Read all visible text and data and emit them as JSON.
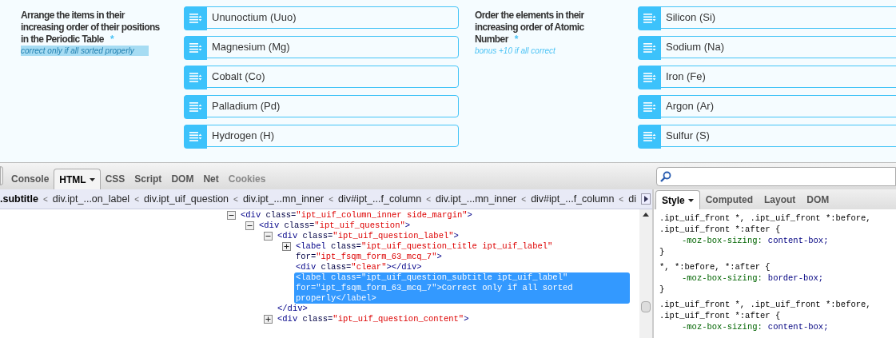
{
  "questions": [
    {
      "title": "Arrange the items in their increasing order of their positions in the Periodic Table",
      "required": "*",
      "subtitle": "correct only if all sorted properly",
      "highlighted": true,
      "items": [
        "Ununoctium (Uuo)",
        "Magnesium (Mg)",
        "Cobalt (Co)",
        "Palladium (Pd)",
        "Hydrogen (H)"
      ]
    },
    {
      "title": "Order the elements in their increasing order of Atomic Number",
      "required": "*",
      "subtitle": "bonus +10 if all correct",
      "highlighted": false,
      "items": [
        "Silicon (Si)",
        "Sodium (Na)",
        "Iron (Fe)",
        "Argon (Ar)",
        "Sulfur (S)"
      ]
    }
  ],
  "devtools": {
    "tabs": [
      {
        "label": "Console",
        "selected": false,
        "disabled": false,
        "menu": false
      },
      {
        "label": "HTML",
        "selected": true,
        "disabled": false,
        "menu": true
      },
      {
        "label": "CSS",
        "selected": false,
        "disabled": false,
        "menu": false
      },
      {
        "label": "Script",
        "selected": false,
        "disabled": false,
        "menu": false
      },
      {
        "label": "DOM",
        "selected": false,
        "disabled": false,
        "menu": false
      },
      {
        "label": "Net",
        "selected": false,
        "disabled": false,
        "menu": false
      },
      {
        "label": "Cookies",
        "selected": false,
        "disabled": true,
        "menu": false
      }
    ],
    "breadcrumbs": [
      {
        "label": ".subtitle",
        "selected": true
      },
      {
        "label": "div.ipt_...on_label",
        "selected": false
      },
      {
        "label": "div.ipt_uif_question",
        "selected": false
      },
      {
        "label": "div.ipt_...mn_inner",
        "selected": false
      },
      {
        "label": "div#ipt_...f_column",
        "selected": false
      },
      {
        "label": "div.ipt_...mn_inner",
        "selected": false
      },
      {
        "label": "div#ipt_...f_column",
        "selected": false
      },
      {
        "label": "di",
        "selected": false
      }
    ],
    "breadcrumb_separator": "<",
    "html_tree": [
      {
        "kind": "element",
        "expanded": true,
        "selected": false,
        "parts": [
          {
            "kind": "tag",
            "text": "<div "
          },
          {
            "kind": "attr",
            "text": "class="
          },
          {
            "kind": "value",
            "text": "\"ipt_uif_column_inner side_margin\""
          },
          {
            "kind": "tag",
            "text": ">"
          }
        ],
        "children": [
          {
            "kind": "element",
            "expanded": true,
            "selected": false,
            "parts": [
              {
                "kind": "tag",
                "text": "<div "
              },
              {
                "kind": "attr",
                "text": "class="
              },
              {
                "kind": "value",
                "text": "\"ipt_uif_question\""
              },
              {
                "kind": "tag",
                "text": ">"
              }
            ],
            "children": [
              {
                "kind": "element",
                "expanded": true,
                "selected": false,
                "parts": [
                  {
                    "kind": "tag",
                    "text": "<div "
                  },
                  {
                    "kind": "attr",
                    "text": "class="
                  },
                  {
                    "kind": "value",
                    "text": "\"ipt_uif_question_label\""
                  },
                  {
                    "kind": "tag",
                    "text": ">"
                  }
                ],
                "children": [
                  {
                    "kind": "element",
                    "expanded": false,
                    "selected": false,
                    "parts": [
                      {
                        "kind": "tag",
                        "text": "<label "
                      },
                      {
                        "kind": "attr",
                        "text": "class="
                      },
                      {
                        "kind": "value",
                        "text": "\"ipt_uif_question_title ipt_uif_label\""
                      },
                      {
                        "kind": "attr",
                        "text": " for="
                      },
                      {
                        "kind": "value",
                        "text": "\"ipt_fsqm_form_63_mcq_7\""
                      },
                      {
                        "kind": "tag",
                        "text": ">"
                      }
                    ]
                  },
                  {
                    "kind": "leaf",
                    "selected": false,
                    "parts": [
                      {
                        "kind": "tag",
                        "text": "<div "
                      },
                      {
                        "kind": "attr",
                        "text": "class="
                      },
                      {
                        "kind": "value",
                        "text": "\"clear\""
                      },
                      {
                        "kind": "tag",
                        "text": "></div>"
                      }
                    ]
                  },
                  {
                    "kind": "leaf",
                    "selected": true,
                    "parts": [
                      {
                        "kind": "tag",
                        "text": "<label "
                      },
                      {
                        "kind": "attr",
                        "text": "class="
                      },
                      {
                        "kind": "value",
                        "text": "\"ipt_uif_question_subtitle ipt_uif_label\""
                      },
                      {
                        "kind": "attr",
                        "text": " for="
                      },
                      {
                        "kind": "value",
                        "text": "\"ipt_fsqm_form_63_mcq_7\""
                      },
                      {
                        "kind": "tag",
                        "text": ">"
                      },
                      {
                        "kind": "text",
                        "text": "Correct only if all sorted properly"
                      },
                      {
                        "kind": "tag",
                        "text": "</label>"
                      }
                    ]
                  }
                ]
              },
              {
                "kind": "leaf",
                "selected": false,
                "parts": [
                  {
                    "kind": "tag",
                    "text": "</div>"
                  }
                ]
              },
              {
                "kind": "element",
                "expanded": false,
                "selected": false,
                "parts": [
                  {
                    "kind": "tag",
                    "text": "<div "
                  },
                  {
                    "kind": "attr",
                    "text": "class="
                  },
                  {
                    "kind": "value",
                    "text": "\"ipt_uif_question_content\""
                  },
                  {
                    "kind": "tag",
                    "text": ">"
                  }
                ]
              }
            ]
          }
        ]
      }
    ],
    "side_tabs": [
      {
        "label": "Style",
        "selected": true,
        "menu": true
      },
      {
        "label": "Computed",
        "selected": false,
        "menu": false
      },
      {
        "label": "Layout",
        "selected": false,
        "menu": false
      },
      {
        "label": "DOM",
        "selected": false,
        "menu": false
      }
    ],
    "css_rules": [
      {
        "selector": ".ipt_uif_front *, .ipt_uif_front *:before, .ipt_uif_front *:after {",
        "declarations": [
          {
            "property": "-moz-box-sizing:",
            "value": "content-box;"
          }
        ],
        "close": "}"
      },
      {
        "selector": "*, *:before, *:after {",
        "declarations": [
          {
            "property": "-moz-box-sizing:",
            "value": "border-box;"
          }
        ],
        "close": "}"
      },
      {
        "selector": ".ipt_uif_front *, .ipt_uif_front *:before, .ipt_uif_front *:after {",
        "declarations": [
          {
            "property": "-moz-box-sizing:",
            "value": "content-box;"
          }
        ]
      }
    ]
  }
}
